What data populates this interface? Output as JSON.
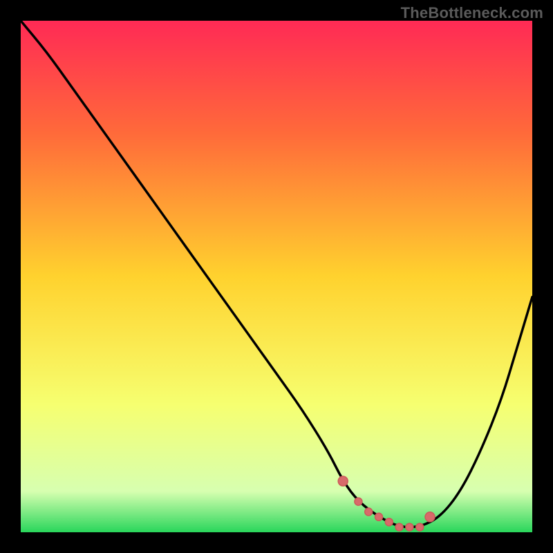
{
  "watermark": "TheBottleneck.com",
  "chart_data": {
    "type": "line",
    "title": "",
    "xlabel": "",
    "ylabel": "",
    "xlim": [
      0,
      100
    ],
    "ylim": [
      0,
      100
    ],
    "gradient_colors": {
      "top": "#ff2a55",
      "upper_mid": "#ff6a3a",
      "mid": "#ffd22e",
      "lower_mid": "#f6ff70",
      "near_bottom": "#d7ffb0",
      "bottom": "#29d65b"
    },
    "series": [
      {
        "name": "bottleneck-curve",
        "x": [
          0,
          5,
          10,
          15,
          20,
          25,
          30,
          35,
          40,
          45,
          50,
          55,
          60,
          63,
          66,
          70,
          74,
          78,
          82,
          86,
          90,
          94,
          97,
          100
        ],
        "y": [
          100,
          94,
          87,
          80,
          73,
          66,
          59,
          52,
          45,
          38,
          31,
          24,
          16,
          10,
          6,
          3,
          1,
          1,
          3,
          8,
          16,
          26,
          36,
          46
        ]
      }
    ],
    "markers": {
      "name": "highlight-points",
      "color": "#d86a6a",
      "x": [
        63,
        66,
        68,
        70,
        72,
        74,
        76,
        78,
        80
      ],
      "y": [
        10,
        6,
        4,
        3,
        2,
        1,
        1,
        1,
        3
      ]
    }
  }
}
